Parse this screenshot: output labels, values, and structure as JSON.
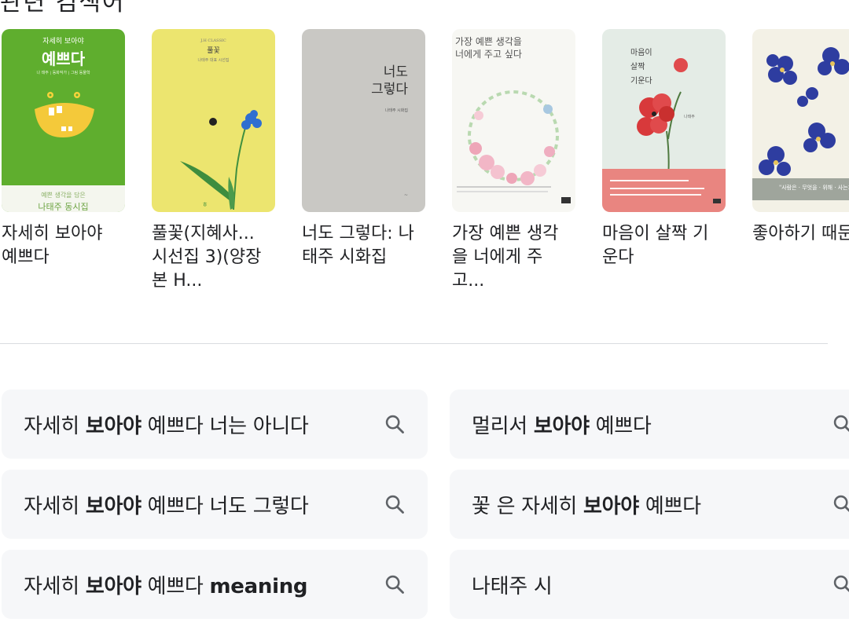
{
  "header": {
    "partial_title": "관련 검색어"
  },
  "books": [
    {
      "title": "자세히 보아야\n예쁘다",
      "cover": {
        "bg": "#5fae2e",
        "small_top": "자세히 보아야",
        "big": "예쁘다",
        "credits": "나 태주 | 동화작가 | 그림 동물학",
        "footer1": "예쁜 생각을 담은",
        "footer2": "나태주 동시집"
      }
    },
    {
      "title": "풀꽃(지혜사...\n시선집 3)(양장\n본 H...",
      "cover": {
        "bg": "#ece56f",
        "small_top": "J.H CLASSIC",
        "big": "풀꽃",
        "credits": "나태주 대표 시선집"
      }
    },
    {
      "title": "너도 그렇다: 나\n태주 시화집",
      "cover": {
        "bg": "#c9c8c4",
        "big": "너도\n그렇다",
        "credits": "나태주 시화집"
      }
    },
    {
      "title": "가장 예쁜 생각\n을 너에게 주\n고...",
      "cover": {
        "bg": "#f7f7f3",
        "big": "가장 예쁜 생각을\n너에게 주고 싶다"
      }
    },
    {
      "title": "마음이 살짝 기\n운다",
      "cover": {
        "bg": "#e4ece6",
        "big": "마음이\n살짝\n기운다",
        "credits": "나태주",
        "band": "#e98580"
      }
    },
    {
      "title": "좋아하기 때문",
      "cover": {
        "bg": "#f3f1e6",
        "band_text": "\"사람은 · 무엇을 · 위해 · 사는가\"",
        "band": "#9fa59c"
      }
    }
  ],
  "suggestions": [
    {
      "pre": "자세히 ",
      "bold": "보아야",
      "post": " 예쁘다 너는 아니다"
    },
    {
      "pre": "멀리서 ",
      "bold": "보아야",
      "post": " 예쁘다"
    },
    {
      "pre": "자세히 ",
      "bold": "보아야",
      "post": " 예쁘다 너도 그렇다"
    },
    {
      "pre": "꽃 은 자세히 ",
      "bold": "보아야",
      "post": " 예쁘다"
    },
    {
      "pre": "자세히 ",
      "bold": "보아야",
      "post": " 예쁘다 ",
      "bold2": "meaning"
    },
    {
      "pre": "나태주 시",
      "bold": "",
      "post": ""
    }
  ],
  "icons": {
    "suggestion_icon": "search-icon"
  },
  "colors": {
    "chip_bg": "#f6f7f9",
    "divider": "#dadce0",
    "text": "#202124"
  }
}
